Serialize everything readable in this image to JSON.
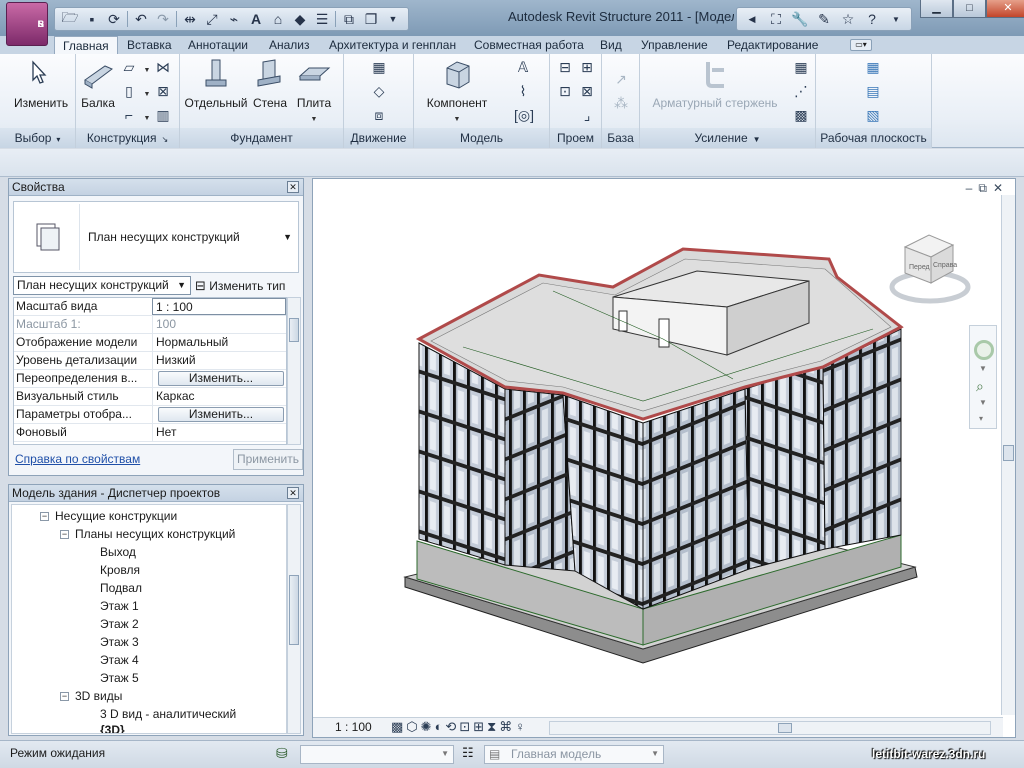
{
  "app": {
    "window_title": "Autodesk Revit Structure 2011 - [Модел...",
    "app_button_letter": "R",
    "app_button_sub": "S"
  },
  "colors": {
    "titlebar": "#8aa5c0",
    "ribbon_bg": "#eef3f8",
    "building_glass": "#b9c4d3",
    "building_red": "#c06a6a",
    "building_concrete": "#c8c8c8"
  },
  "ribbon_tabs": [
    "Главная",
    "Вставка",
    "Аннотации",
    "Анализ",
    "Архитектура и генплан",
    "Совместная работа",
    "Вид",
    "Управление",
    "Редактирование"
  ],
  "ribbon": {
    "modify": "Изменить",
    "beam": "Балка",
    "isolated": "Отдельный",
    "wall": "Стена",
    "slab": "Плита",
    "component": "Компонент",
    "rebar": "Арматурный стержень",
    "panels": {
      "select": "Выбор",
      "structure": "Конструкция",
      "foundation": "Фундамент",
      "circulation": "Движение",
      "model": "Модель",
      "opening": "Проем",
      "datum": "База",
      "reinforcement": "Усиление",
      "workplane": "Рабочая плоскость"
    }
  },
  "properties": {
    "title": "Свойства",
    "type_name": "План несущих конструкций",
    "instance_dropdown": "План несущих конструкций",
    "edit_type": "Изменить тип",
    "rows": [
      {
        "key": "Масштаб вида",
        "value": "1 : 100"
      },
      {
        "key": "Масштаб  1:",
        "value": "100"
      },
      {
        "key": "Отображение модели",
        "value": "Нормальный"
      },
      {
        "key": "Уровень детализации",
        "value": "Низкий"
      },
      {
        "key": "Переопределения в...",
        "value": "Изменить..."
      },
      {
        "key": "Визуальный стиль",
        "value": "Каркас"
      },
      {
        "key": "Параметры отобра...",
        "value": "Изменить..."
      },
      {
        "key": "Фоновый",
        "value": "Нет"
      }
    ],
    "help_link": "Справка по свойствам",
    "apply": "Применить"
  },
  "browser": {
    "title": "Модель здания - Диспетчер проектов",
    "nodes": [
      {
        "label": "Несущие конструкции",
        "exp": "−"
      },
      {
        "label": "Планы несущих конструкций",
        "exp": "−"
      },
      {
        "label": "Выход",
        "exp": ""
      },
      {
        "label": "Кровля",
        "exp": ""
      },
      {
        "label": "Подвал",
        "exp": ""
      },
      {
        "label": "Этаж 1",
        "exp": ""
      },
      {
        "label": "Этаж 2",
        "exp": ""
      },
      {
        "label": "Этаж 3",
        "exp": ""
      },
      {
        "label": "Этаж 4",
        "exp": ""
      },
      {
        "label": "Этаж 5",
        "exp": ""
      },
      {
        "label": "3D виды",
        "exp": "−"
      },
      {
        "label": "3 D вид  - аналитический",
        "exp": ""
      },
      {
        "label": "{3D}",
        "exp": ""
      }
    ]
  },
  "viewport": {
    "scale": "1 : 100",
    "viewcube_left": "Перед",
    "viewcube_right": "Справа"
  },
  "status": {
    "text": "Режим ожидания",
    "model_dropdown": "Главная модель",
    "watermark": "letitbit-warez.3dn.ru"
  }
}
